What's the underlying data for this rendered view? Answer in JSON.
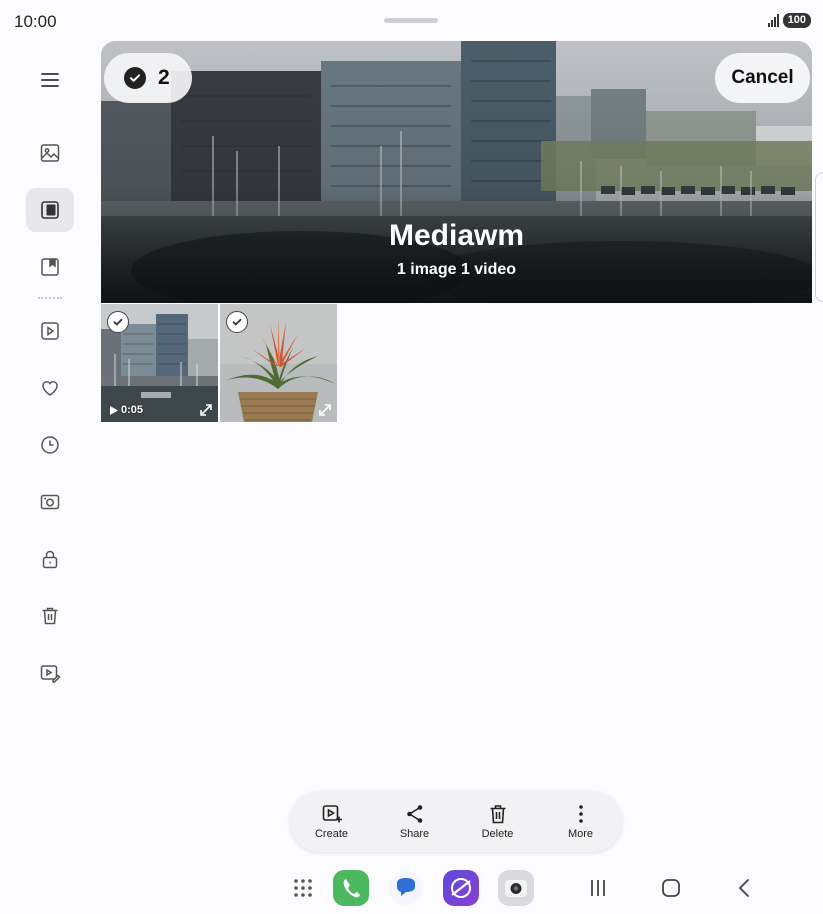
{
  "status_bar": {
    "time": "10:00",
    "battery": "100"
  },
  "album": {
    "title": "Mediawm",
    "subtitle": "1 image 1 video"
  },
  "selection": {
    "count": "2",
    "cancel_label": "Cancel"
  },
  "sidebar": {
    "items": [
      {
        "name": "menu",
        "icon": "hamburger-menu-icon"
      },
      {
        "name": "pictures",
        "icon": "image-icon"
      },
      {
        "name": "albums",
        "icon": "album-icon",
        "active": true
      },
      {
        "name": "stories",
        "icon": "bookmark-album-icon"
      },
      {
        "name": "videos",
        "icon": "video-icon"
      },
      {
        "name": "favourites",
        "icon": "heart-icon"
      },
      {
        "name": "recent",
        "icon": "clock-icon"
      },
      {
        "name": "screenshots",
        "icon": "camera-icon"
      },
      {
        "name": "secure-folder",
        "icon": "lock-icon"
      },
      {
        "name": "recycle-bin",
        "icon": "trash-icon"
      },
      {
        "name": "video-editor",
        "icon": "video-edit-icon"
      }
    ]
  },
  "items": [
    {
      "type": "video",
      "duration": "0:05",
      "selected": true
    },
    {
      "type": "image",
      "selected": true
    }
  ],
  "actions": [
    {
      "label": "Create",
      "icon": "create-icon"
    },
    {
      "label": "Share",
      "icon": "share-icon"
    },
    {
      "label": "Delete",
      "icon": "trash-icon"
    },
    {
      "label": "More",
      "icon": "more-vertical-icon"
    }
  ],
  "taskbar": {
    "apps": [
      "apps-grid-icon",
      "phone-app-icon",
      "messages-app-icon",
      "internet-app-icon",
      "camera-app-icon"
    ],
    "nav": [
      "recents-icon",
      "home-icon",
      "back-icon"
    ]
  }
}
